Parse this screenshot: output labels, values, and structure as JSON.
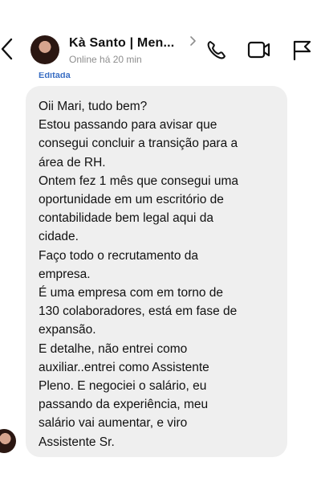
{
  "header": {
    "contact_name": "Kà Santo | Men...",
    "status": "Online há 20 min",
    "icons": {
      "back": "chevron-left-icon",
      "profile_chevron": "chevron-right-icon",
      "call": "phone-icon",
      "video": "video-camera-icon",
      "report": "flag-icon"
    }
  },
  "conversation": {
    "edited_label": "Editada",
    "message_paragraphs": [
      "Oii Mari, tudo bem?",
      "Estou passando para avisar que\nconsegui concluir a transição para a\nárea de RH.",
      "Ontem fez 1 mês que consegui uma\noportunidade em um escritório de\ncontabilidade bem legal aqui da\ncidade.",
      "Faço todo o recrutamento da\nempresa.",
      "É uma empresa com em torno de\n130 colaboradores, está em fase de\nexpansão.",
      "E detalhe, não entrei como\nauxiliar..entrei como Assistente\nPleno. E negociei o salário, eu\npassando da experiência, meu\nsalário vai aumentar, e viro\nAssistente Sr."
    ]
  },
  "colors": {
    "bubble": "#efefef",
    "edited": "#3b6fc4",
    "status": "#8e8e8e"
  }
}
